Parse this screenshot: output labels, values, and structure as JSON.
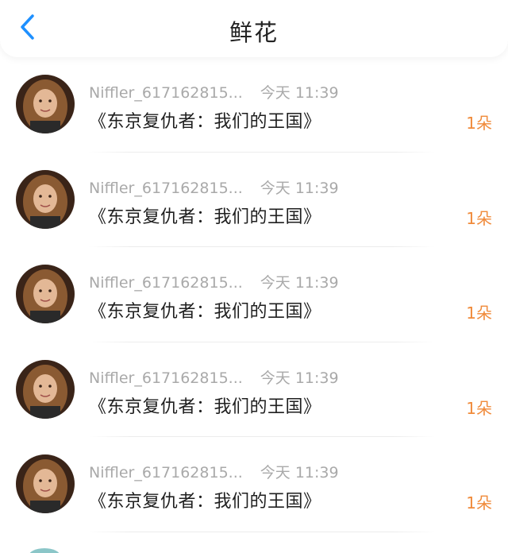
{
  "header": {
    "title": "鲜花"
  },
  "colors": {
    "accent_blue": "#1e90ff",
    "count_orange": "#f08a3a"
  },
  "items": [
    {
      "user": "Niffler_617162815...",
      "time": "今天 11:39",
      "work": "《东京复仇者：我们的王国》",
      "count": "1朵"
    },
    {
      "user": "Niffler_617162815...",
      "time": "今天 11:39",
      "work": "《东京复仇者：我们的王国》",
      "count": "1朵"
    },
    {
      "user": "Niffler_617162815...",
      "time": "今天 11:39",
      "work": "《东京复仇者：我们的王国》",
      "count": "1朵"
    },
    {
      "user": "Niffler_617162815...",
      "time": "今天 11:39",
      "work": "《东京复仇者：我们的王国》",
      "count": "1朵"
    },
    {
      "user": "Niffler_617162815...",
      "time": "今天 11:39",
      "work": "《东京复仇者：我们的王国》",
      "count": "1朵"
    }
  ]
}
